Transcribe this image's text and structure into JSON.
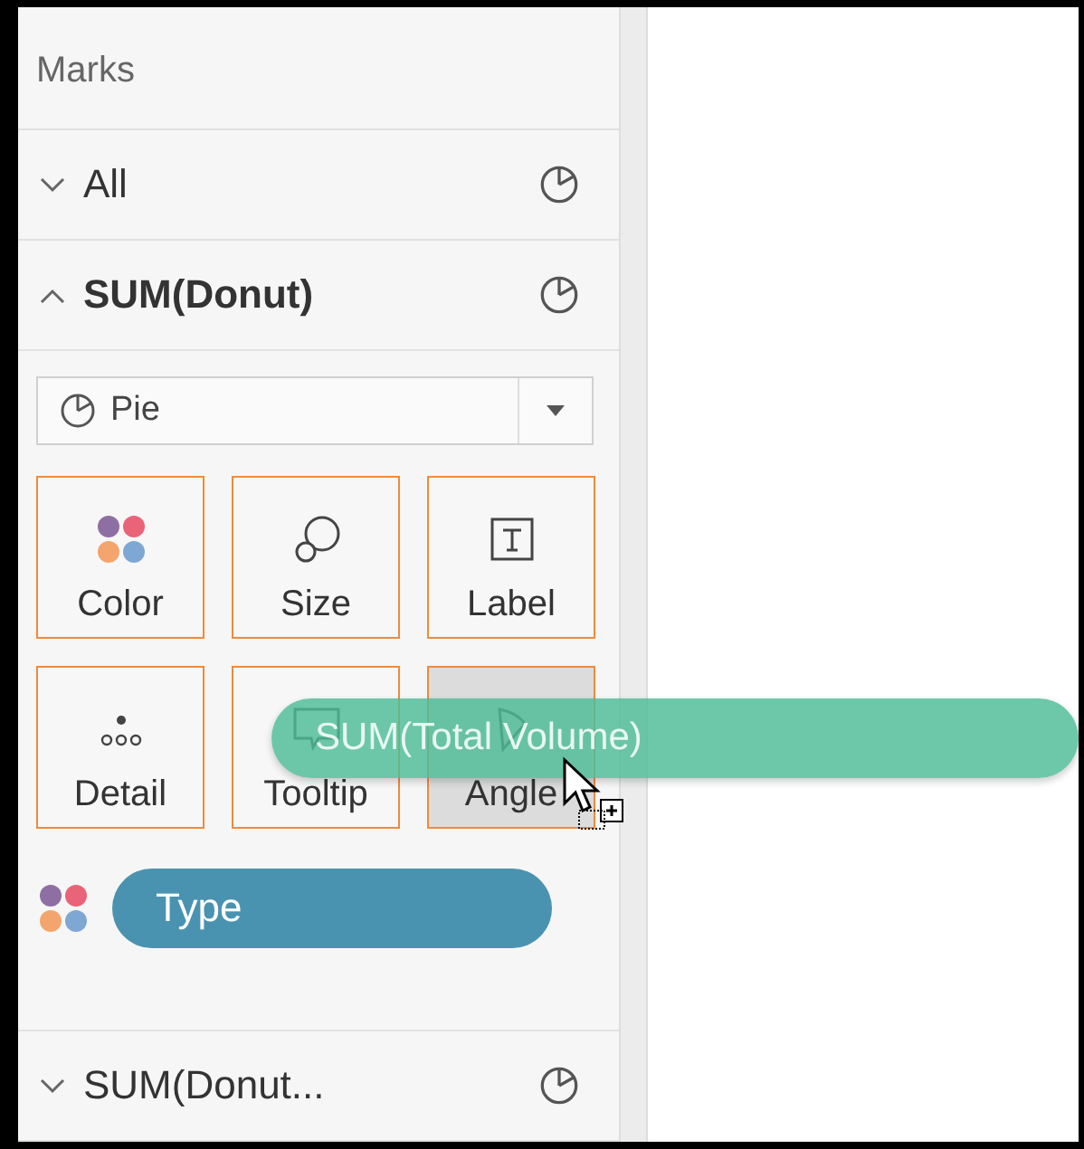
{
  "panel": {
    "title": "Marks"
  },
  "cards": [
    {
      "label": "All",
      "expanded": false
    },
    {
      "label": "SUM(Donut)",
      "expanded": true,
      "mark_type": "Pie",
      "shelves": [
        {
          "kind": "color",
          "label": "Color",
          "highlighted": false
        },
        {
          "kind": "size",
          "label": "Size",
          "highlighted": false
        },
        {
          "kind": "label",
          "label": "Label",
          "highlighted": false
        },
        {
          "kind": "detail",
          "label": "Detail",
          "highlighted": false
        },
        {
          "kind": "tooltip",
          "label": "Tooltip",
          "highlighted": false
        },
        {
          "kind": "angle",
          "label": "Angle",
          "highlighted": true
        }
      ],
      "pills": [
        {
          "kind": "color",
          "label": "Type"
        }
      ]
    },
    {
      "label": "SUM(Donut...",
      "expanded": false
    }
  ],
  "drag_pill": {
    "label": "SUM(Total Volume)"
  }
}
